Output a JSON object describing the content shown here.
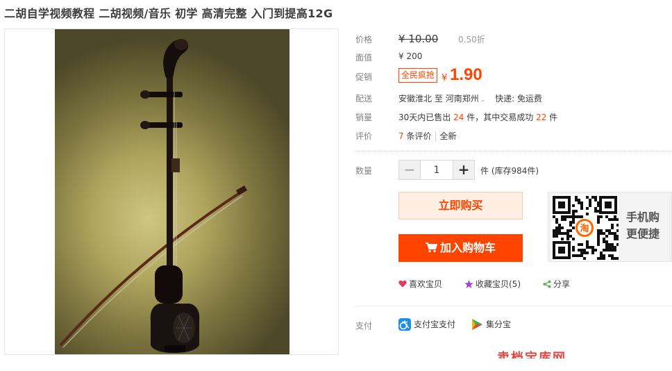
{
  "product": {
    "title": "二胡自学视频教程 二胡视频/音乐 初学 高清完整 入门到提高12G"
  },
  "price": {
    "label": "价格",
    "original": "¥ 10.00",
    "discount": "0.50折"
  },
  "face_value": {
    "label": "面值",
    "value": "¥ 200"
  },
  "promo": {
    "label": "促销",
    "tag": "全民疯抢",
    "currency": "¥",
    "price": "1.90"
  },
  "shipping": {
    "label": "配送",
    "from": "安徽淮北",
    "to_word": "至",
    "destination": "河南郑州",
    "express": "快递: 免运费"
  },
  "sales": {
    "label": "销量",
    "prefix": "30天内已售出",
    "sold": "24",
    "middle": "件，其中交易成功",
    "success": "22",
    "suffix": "件"
  },
  "reviews": {
    "label": "评价",
    "count": "7",
    "count_text": "条评价",
    "all": "全新"
  },
  "quantity": {
    "label": "数量",
    "value": "1",
    "minus": "−",
    "plus": "+",
    "stock_text": "件 (库存984件)"
  },
  "actions": {
    "buy_now": "立即购买",
    "add_cart": "加入购物车"
  },
  "mobile": {
    "line1": "手机购",
    "line2": "更便捷"
  },
  "social": {
    "like": "喜欢宝贝",
    "favorite": "收藏宝贝(5)",
    "share": "分享"
  },
  "payment": {
    "label": "支付",
    "alipay": "支付宝支付",
    "jifenbao": "集分宝"
  },
  "section_heading": "卖档宝库网",
  "colors": {
    "accent": "#ff4400",
    "label_gray": "#838383",
    "buy_bg": "#ffeee2"
  },
  "icons": [
    "cart-icon",
    "heart-icon",
    "star-icon",
    "share-icon",
    "alipay-icon",
    "jifenbao-icon",
    "qr-code-icon",
    "chevron-down-icon"
  ]
}
